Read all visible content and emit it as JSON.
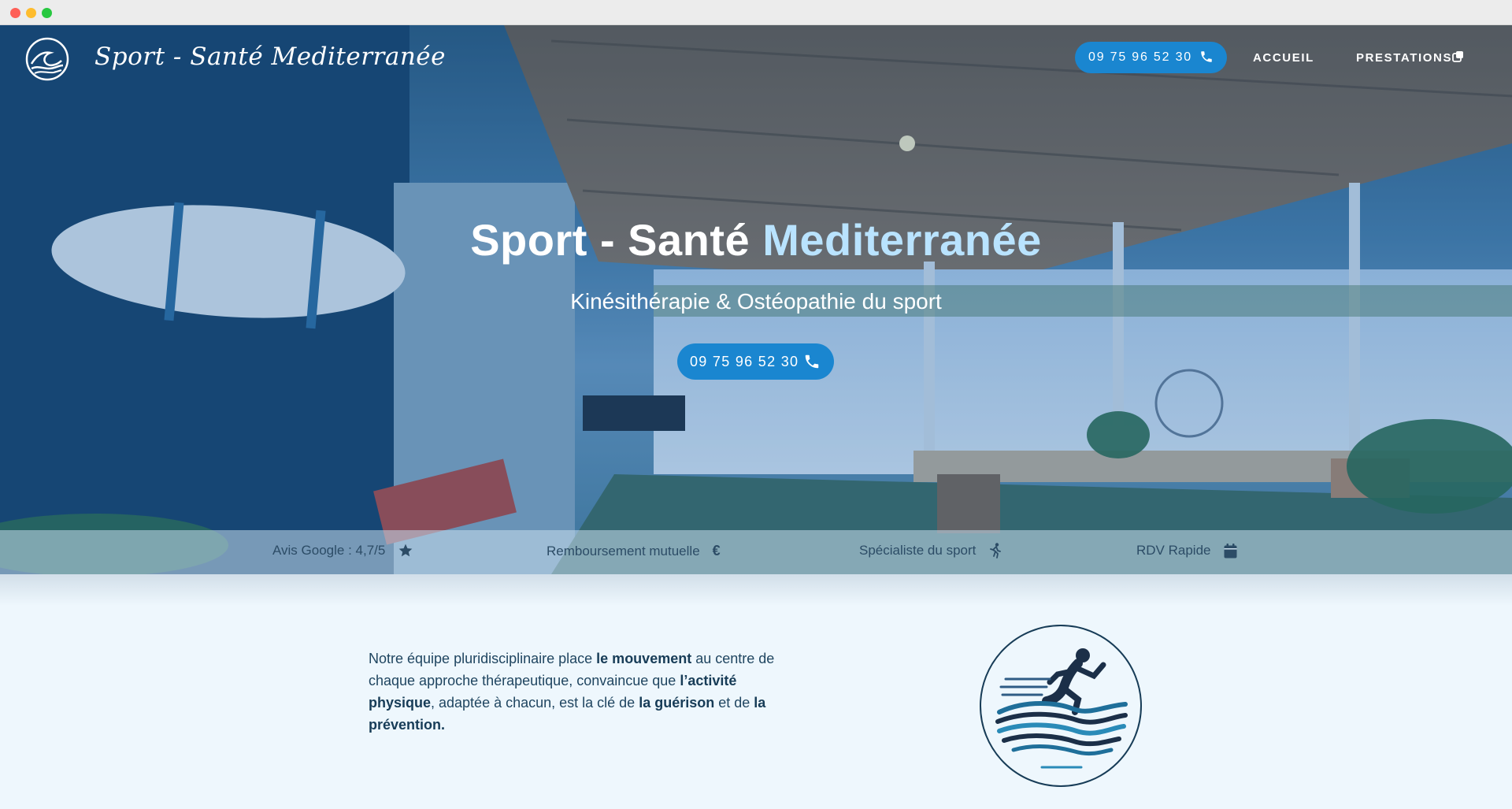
{
  "header": {
    "brand": "Sport - Santé Mediterranée",
    "phone": "09 75 96 52 30",
    "nav": [
      {
        "label": "ACCUEIL"
      },
      {
        "label": "PRESTATIONS"
      }
    ]
  },
  "hero": {
    "title_main": "Sport - Santé ",
    "title_accent": "Mediterranée",
    "subtitle": "Kinésithérapie & Ostéopathie du sport",
    "cta_phone": "09 75 96 52 30"
  },
  "features": [
    {
      "label": "Avis Google : 4,7/5",
      "icon": "star-icon"
    },
    {
      "label": "Remboursement mutuelle",
      "icon": "euro-icon"
    },
    {
      "label": "Spécialiste du sport",
      "icon": "running-icon"
    },
    {
      "label": "RDV Rapide",
      "icon": "calendar-icon"
    }
  ],
  "intro": {
    "p1": "Notre équipe pluridisciplinaire place ",
    "b1": "le mouvement",
    "p2": " au centre de chaque approche thérapeutique, convaincue que ",
    "b2": "l’activité physique",
    "p3": ", adaptée à chacun, est la clé de ",
    "b3": "la guérison",
    "p4": " et de ",
    "b4": "la prévention."
  },
  "colors": {
    "accent": "#1a86d0",
    "title_accent": "#b9e3ff",
    "page_bg": "#eef7fd",
    "text_dark": "#1f4560"
  }
}
